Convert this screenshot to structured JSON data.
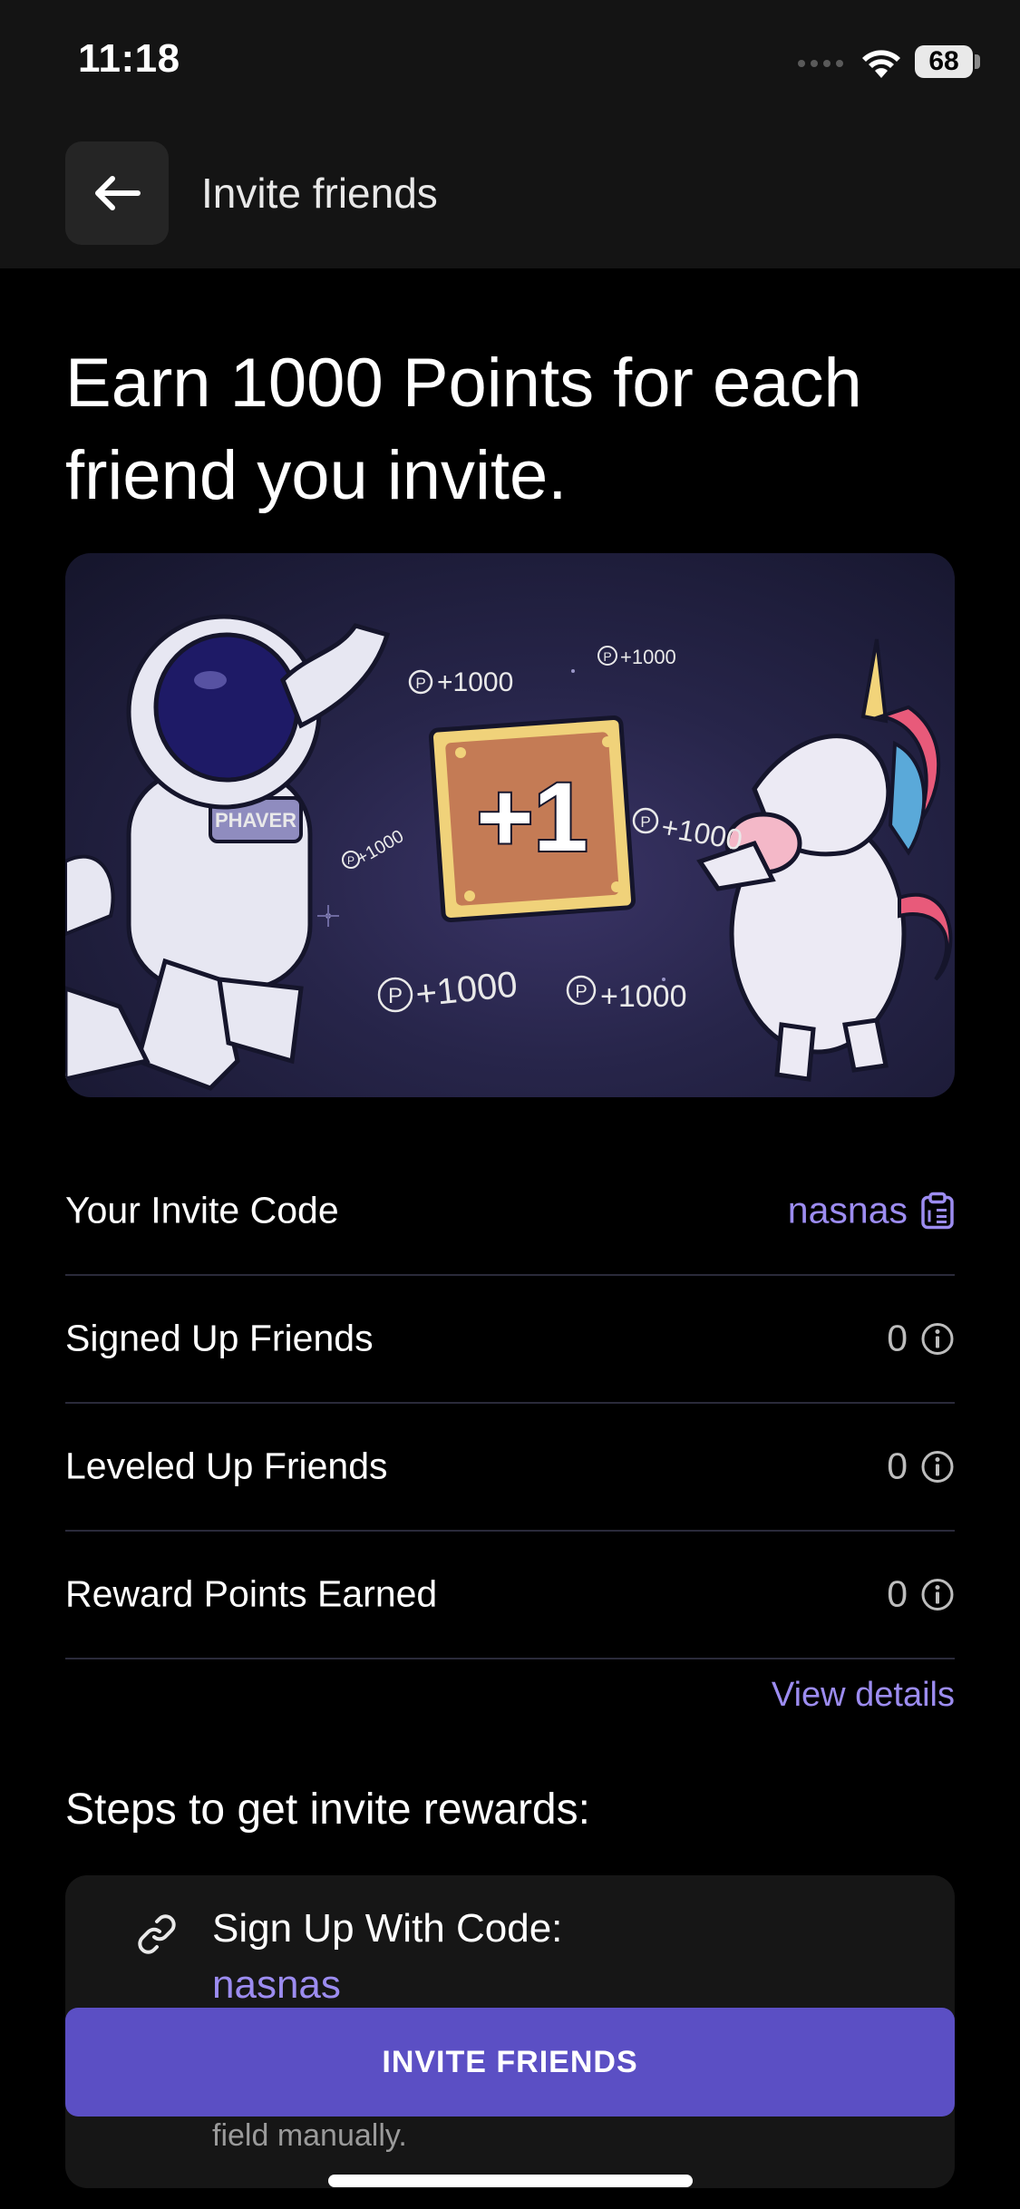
{
  "status": {
    "time": "11:18",
    "battery": "68"
  },
  "header": {
    "title": "Invite friends"
  },
  "headline": "Earn 1000 Points for each friend you invite.",
  "hero": {
    "badge": "+1",
    "point_labels": [
      "+1000",
      "+1000",
      "+1000",
      "+1000",
      "+1000",
      "+1000"
    ],
    "patch_text": "PHAVER",
    "point_glyph": "P"
  },
  "stats": {
    "invite_code_label": "Your Invite Code",
    "invite_code": "nasnas",
    "rows": [
      {
        "label": "Signed Up Friends",
        "value": "0"
      },
      {
        "label": "Leveled Up Friends",
        "value": "0"
      },
      {
        "label": "Reward Points Earned",
        "value": "0"
      }
    ],
    "view_details": "View details"
  },
  "steps": {
    "title": "Steps to get invite rewards:",
    "step1_title": "Sign Up With Code:",
    "step1_code": "nasnas",
    "step1_note": "field manually."
  },
  "cta": {
    "label": "INVITE FRIENDS"
  },
  "colors": {
    "accent": "#9c8cf0",
    "button": "#5b4fc4",
    "background": "#000000",
    "header": "#141414"
  },
  "icons": [
    "back-arrow-icon",
    "wifi-icon",
    "clipboard-icon",
    "info-icon",
    "link-icon"
  ]
}
